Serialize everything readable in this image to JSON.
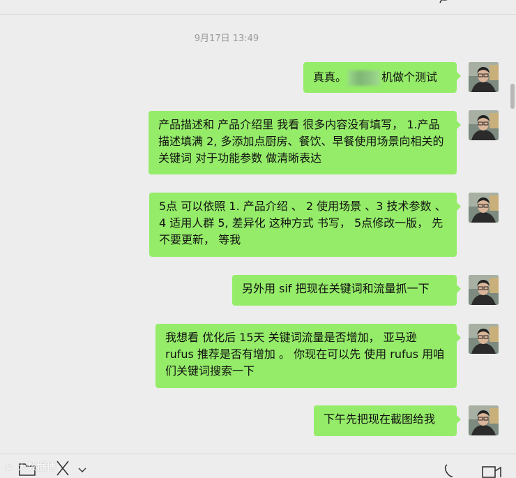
{
  "chat": {
    "timestamp": "9月17日 13:49",
    "messages": [
      {
        "pre": "真真。",
        "post": "机做个测试"
      },
      {
        "text": "产品描述和 产品介绍里 我看 很多内容没有填写， 1.产品描述填满  2,  多添加点厨房、餐饮、早餐使用场景向相关的关键词 对于功能参数 做清晰表达"
      },
      {
        "text": "5点  可以依照  1.  产品介绍 、  2 使用场景  、3 技术参数 、 4 适用人群 5,   差异化 这种方式 书写，   5点修改一版，  先不要更新，  等我"
      },
      {
        "text": "另外用 sif 把现在关键词和流量抓一下"
      },
      {
        "text": "我想看 优化后 15天  关键词流量是否增加，   亚马逊 rufus 推荐是否有增加 。  你现在可以先  使用 rufus 用咱们关键词搜索一下"
      },
      {
        "text": "下午先把现在截图给我"
      }
    ]
  },
  "watermark": "大数据博",
  "icons": {
    "top": "chat-more-icon",
    "bottom": [
      "folder-icon",
      "scissors-icon",
      "chevron-down-icon",
      "voice-call-icon",
      "video-call-icon"
    ]
  },
  "colors": {
    "bubble": "#95ec69",
    "background": "#ededed"
  }
}
